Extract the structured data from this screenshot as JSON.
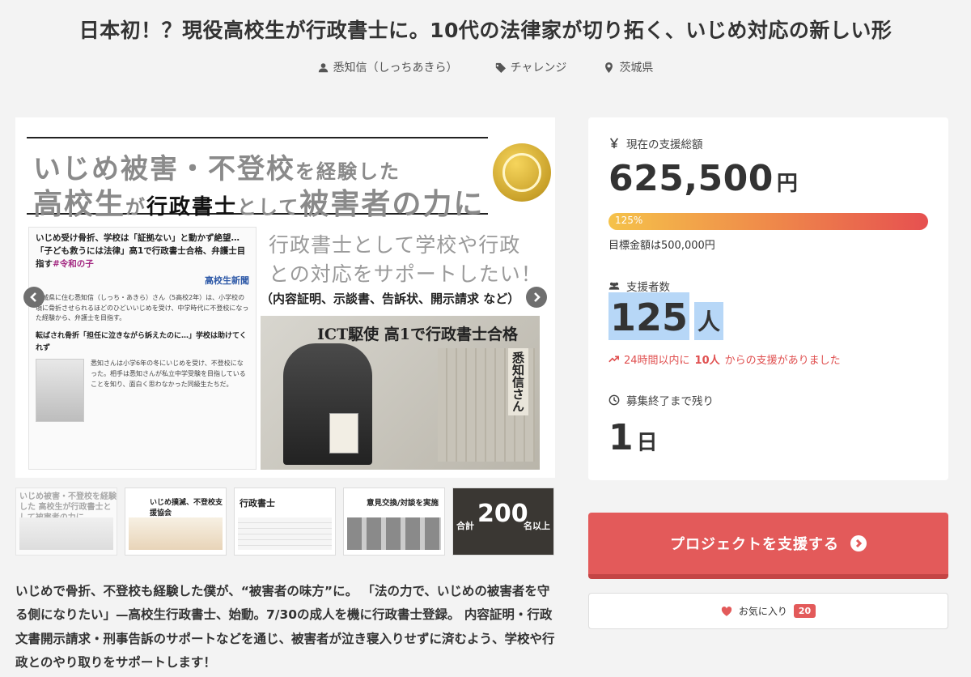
{
  "project": {
    "title": "日本初！？現役高校生が行政書士に。10代の法律家が切り拓く、いじめ対応の新しい形",
    "owner": "悉知信（しっちあきら）",
    "category": "チャレンジ",
    "location": "茨城県"
  },
  "hero": {
    "line1_a": "いじめ被害・不登校",
    "line1_b": "を経験した",
    "line2_a": "高校生",
    "line2_b": "が",
    "line2_c": "行政書士",
    "line2_d": "として",
    "line2_e": "被害者の力に",
    "news_headline": "いじめ受け骨折、学校は「証拠ない」と動かず絶望…「子ども救うには法律」高1で行政書士合格、弁護士目指す",
    "news_tag": "#令和の子",
    "news_brand": "高校生新聞",
    "news_body": "茨城県に住む悉知信（しっち・あきら）さん（5高校2年）は、小学校の頃に骨折させられるほどのひどいいじめを受け、中学時代に不登校になった経験から、弁護士を目指す。",
    "news_sub": "転ばされ骨折「担任に泣きながら訴えたのに…」学校は助けてくれず",
    "news_body2": "悉知さんは小学6年の冬にいじめを受け、不登校になった。相手は悉知さんが私立中学受験を目指していることを知り、面白く思わなかった同級生たちだ。",
    "caption_line1": "行政書士として学校や行政",
    "caption_line2": "との対応をサポートしたい！",
    "caption_sub": "（内容証明、示談書、告訴状、開示請求 など）",
    "clip_headline": "ICT駆使 高1で行政書士合格",
    "clip_name": "悉知信さん"
  },
  "thumbnails": [
    {
      "text": "いじめ被害・不登校を経験した 高校生が行政書士として被害者の力に"
    },
    {
      "text": "いじめ撲滅、不登校支援協会"
    },
    {
      "text": "行政書士"
    },
    {
      "text": "意見交換/対談を実施"
    },
    {
      "big": "200",
      "left": "合計",
      "right": "名以上"
    }
  ],
  "description": "いじめで骨折、不登校も経験した僕が、“被害者の味方”に。 「法の力で、いじめの被害者を守る側になりたい」—高校生行政書士、始動。7/30の成人を機に行政書士登録。 内容証明・行政文書開示請求・刑事告訴のサポートなどを通じ、被害者が泣き寝入りせずに済むよう、学校や行政とのやり取りをサポートします！",
  "stats": {
    "amount_label": "現在の支援総額",
    "amount": "625,500",
    "amount_unit": "円",
    "progress_percent": 125,
    "progress_text": "125%",
    "goal_text": "目標金額は500,000円",
    "backers_label": "支援者数",
    "backers": "125",
    "backers_unit": "人",
    "recent_prefix": "24時間以内に",
    "recent_count": "10人",
    "recent_suffix": "からの支援がありました",
    "remain_label": "募集終了まで残り",
    "remain": "1",
    "remain_unit": "日"
  },
  "actions": {
    "support_label": "プロジェクトを支援する",
    "favorite_label": "お気に入り",
    "favorite_count": "20"
  },
  "colors": {
    "accent": "#e35a5a",
    "highlight": "#b7d7f7"
  }
}
